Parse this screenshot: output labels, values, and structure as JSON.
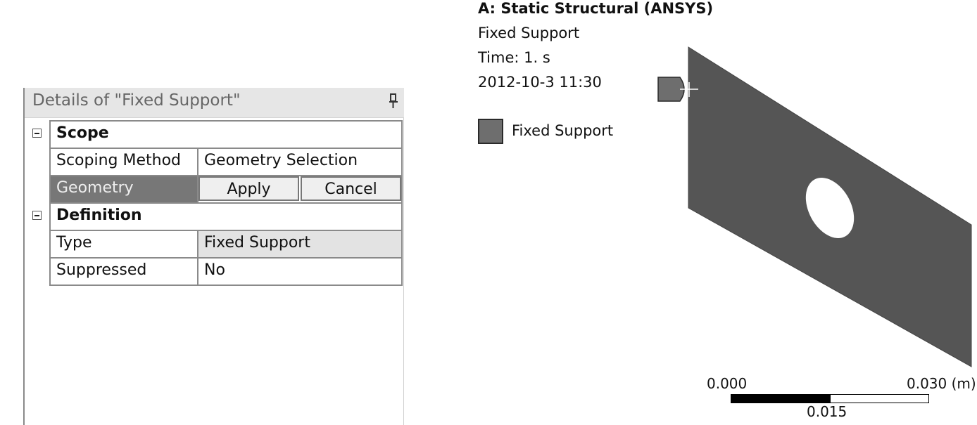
{
  "details": {
    "title": "Details of \"Fixed Support\"",
    "pin_icon": "pin-icon",
    "categories": {
      "scope": "Scope",
      "definition": "Definition"
    },
    "rows": {
      "scoping_method": {
        "label": "Scoping Method",
        "value": "Geometry Selection"
      },
      "geometry": {
        "label": "Geometry",
        "apply": "Apply",
        "cancel": "Cancel"
      },
      "type": {
        "label": "Type",
        "value": "Fixed Support"
      },
      "suppressed": {
        "label": "Suppressed",
        "value": "No"
      }
    }
  },
  "viewport": {
    "title": "A: Static Structural (ANSYS)",
    "object_name": "Fixed Support",
    "time": "Time: 1. s",
    "timestamp": "2012-10-3 11:30",
    "legend_label": "Fixed Support",
    "legend_color": "#6e6e6e",
    "plate_color": "#555555",
    "scale": {
      "left": "0.000",
      "mid": "0.015",
      "right": "0.030 (m)"
    }
  }
}
